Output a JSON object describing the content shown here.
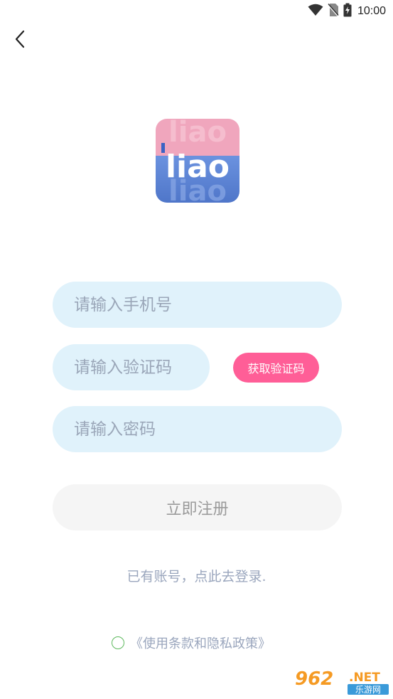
{
  "status_bar": {
    "time": "10:00",
    "icons": [
      "wifi-icon",
      "no-sim-icon",
      "battery-charging-icon"
    ]
  },
  "header": {
    "back_icon": "chevron-left-icon"
  },
  "logo": {
    "text": "liao",
    "colors": {
      "top": "#f0a6bd",
      "bottom": "#5d86d8"
    }
  },
  "form": {
    "phone_placeholder": "请输入手机号",
    "code_placeholder": "请输入验证码",
    "get_code_label": "获取验证码",
    "password_placeholder": "请输入密码",
    "register_label": "立即注册"
  },
  "login_link": "已有账号，点此去登录.",
  "policy": {
    "label": "《使用条款和隐私政策》",
    "checked": false
  },
  "watermark": {
    "brand": "962",
    "suffix": ".NET",
    "subtitle": "乐游网"
  },
  "colors": {
    "accent_pink": "#ff5e97",
    "field_bg": "#e0f2fb",
    "link_text": "#9aa6bd"
  }
}
